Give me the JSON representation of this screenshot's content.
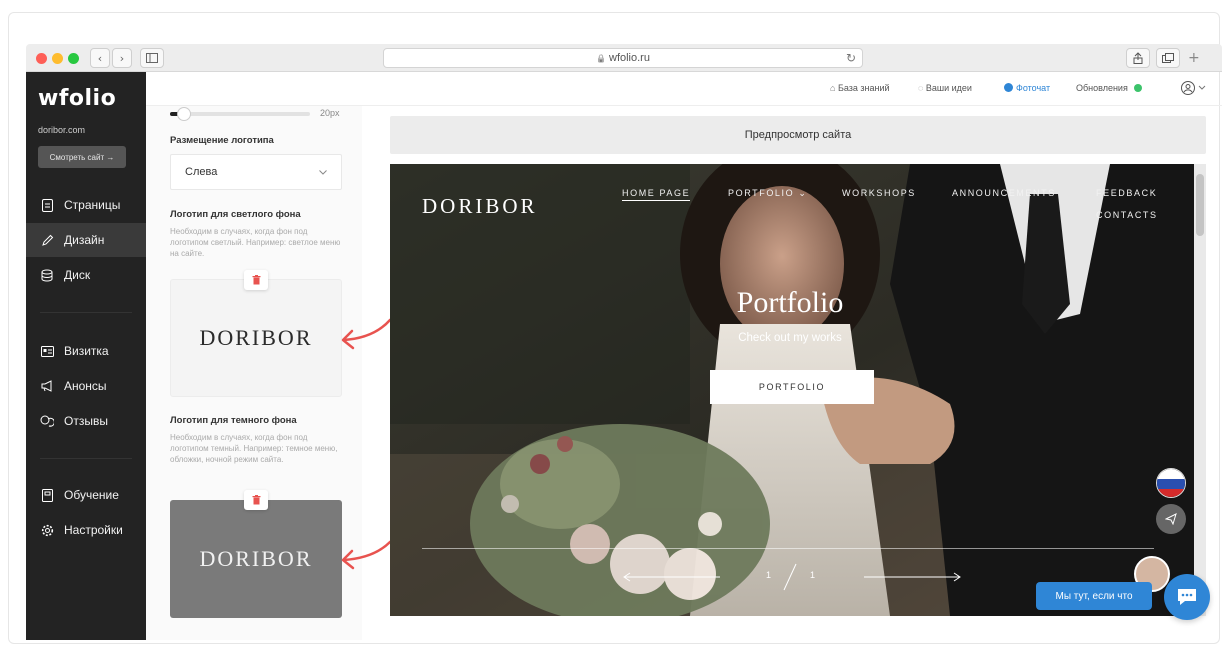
{
  "browser": {
    "url": "wfolio.ru",
    "lock_glyph": "🔒"
  },
  "sidebar": {
    "logo": "wfolio",
    "domain": "doribor.com",
    "view_site_button": "Смотреть сайт →",
    "items": [
      {
        "label": "Страницы",
        "icon": "page-icon"
      },
      {
        "label": "Дизайн",
        "icon": "pencil-icon",
        "active": true
      },
      {
        "label": "Диск",
        "icon": "database-icon"
      },
      {
        "label": "Визитка",
        "icon": "card-icon"
      },
      {
        "label": "Анонсы",
        "icon": "megaphone-icon"
      },
      {
        "label": "Отзывы",
        "icon": "comments-icon"
      },
      {
        "label": "Обучение",
        "icon": "book-icon"
      },
      {
        "label": "Настройки",
        "icon": "gear-icon"
      }
    ]
  },
  "topbar": {
    "knowledge": "База знаний",
    "ideas": "Ваши идеи",
    "photochat": "Фоточат",
    "updates": "Обновления"
  },
  "panel": {
    "slider_value": "20px",
    "slider_fraction": 0.1,
    "logo_position_label": "Размещение логотипа",
    "logo_position_value": "Слева",
    "light_logo_title": "Логотип для светлого фона",
    "light_logo_desc": "Необходим в случаях, когда фон под логотипом светлый. Например: светлое меню на сайте.",
    "light_logo_text": "DORIBOR",
    "dark_logo_title": "Логотип для темного фона",
    "dark_logo_desc": "Необходим в случаях, когда фон под логотипом темный. Например: темное меню, обложки, ночной режим сайта.",
    "dark_logo_text": "DORIBOR"
  },
  "preview": {
    "bar_label": "Предпросмотр сайта",
    "site_logo": "DORIBOR",
    "nav": {
      "home": "HOME PAGE",
      "portfolio": "PORTFOLIO",
      "workshops": "WORKSHOPS",
      "announcements": "ANNOUNCEMENTS",
      "feedback": "FEEDBACK",
      "contacts": "CONTACTS"
    },
    "hero_title": "Portfolio",
    "hero_subtitle": "Check out my works",
    "hero_button": "PORTFOLIO",
    "slide_current": "1",
    "slide_total": "1"
  },
  "chat": {
    "pill_text": "Мы тут, если что"
  },
  "colors": {
    "sidebar_bg": "#232323",
    "accent_red": "#e8534f",
    "chat_blue": "#2f86d6",
    "online_green": "#3cc36b"
  }
}
